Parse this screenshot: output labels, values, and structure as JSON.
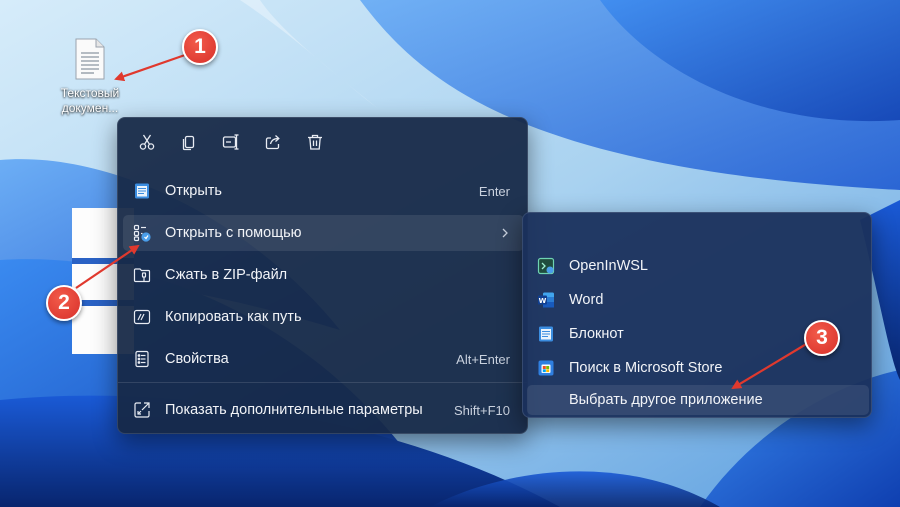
{
  "desktop": {
    "file_label": "Текстовый докумен..."
  },
  "quick_actions": [
    {
      "icon": "scissors-icon"
    },
    {
      "icon": "copy-icon"
    },
    {
      "icon": "rename-icon"
    },
    {
      "icon": "share-icon"
    },
    {
      "icon": "trash-icon"
    }
  ],
  "menu": {
    "items": [
      {
        "label": "Открыть",
        "shortcut": "Enter",
        "icon": "notepad-icon"
      },
      {
        "label": "Открыть с помощью",
        "shortcut": "",
        "icon": "open-with-icon"
      },
      {
        "label": "Сжать в ZIP-файл",
        "shortcut": "",
        "icon": "zip-folder-icon"
      },
      {
        "label": "Копировать как путь",
        "shortcut": "",
        "icon": "copy-path-icon"
      },
      {
        "label": "Свойства",
        "shortcut": "Alt+Enter",
        "icon": "properties-icon"
      },
      {
        "label": "Показать дополнительные параметры",
        "shortcut": "Shift+F10",
        "icon": "more-options-icon"
      }
    ]
  },
  "submenu": {
    "items": [
      {
        "label": "OpenInWSL",
        "icon": "wsl-icon"
      },
      {
        "label": "Word",
        "icon": "word-icon"
      },
      {
        "label": "Блокнот",
        "icon": "notepad-icon"
      },
      {
        "label": "Поиск в Microsoft Store",
        "icon": "store-icon"
      },
      {
        "label": "Выбрать другое приложение",
        "icon": ""
      }
    ]
  },
  "badges": [
    "1",
    "2",
    "3"
  ],
  "colors": {
    "menu_bg": "#16284a",
    "badge_red": "#e0392e",
    "accent_blue": "#4a9eea"
  }
}
